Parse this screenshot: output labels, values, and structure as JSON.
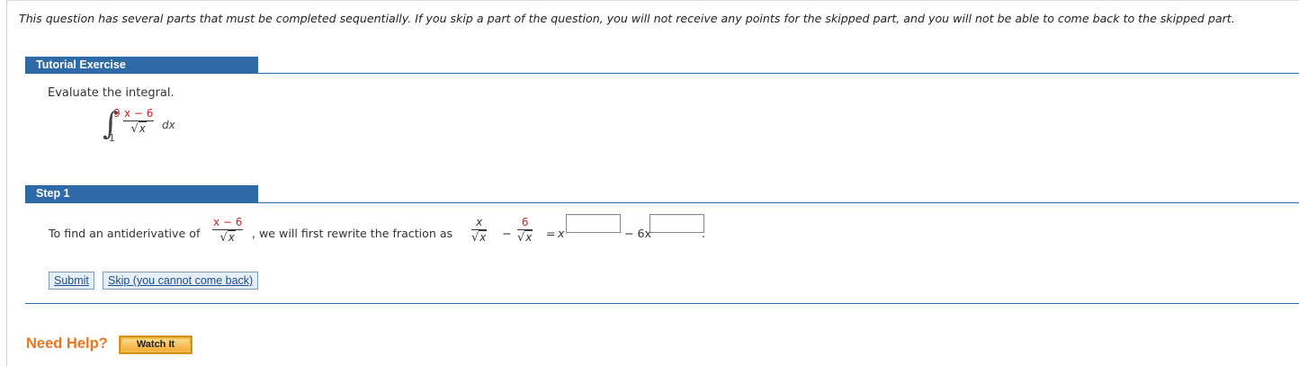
{
  "notice": "This question has several parts that must be completed sequentially. If you skip a part of the question, you will not receive any points for the skipped part, and you will not be able to come back to the skipped part.",
  "tutorial": {
    "header": "Tutorial Exercise",
    "prompt": "Evaluate the integral.",
    "integral": {
      "upper_limit": "9",
      "lower_limit": "1",
      "numerator": "x − 6",
      "radicand": "x",
      "differential": "dx"
    }
  },
  "step1": {
    "header": "Step 1",
    "text_before": "To find an antiderivative of",
    "frac_numerator": "x − 6",
    "frac_radicand": "x",
    "text_middle": ", we will first rewrite the fraction as",
    "term1_numerator": "x",
    "term1_radicand": "x",
    "minus": "−",
    "term2_numerator": "6",
    "term2_radicand": "x",
    "equals": "=",
    "base1": "x",
    "coef2": "− 6x",
    "period": ".",
    "answer1_value": "",
    "answer2_value": ""
  },
  "buttons": {
    "submit": "Submit",
    "skip": "Skip (you cannot come back)"
  },
  "help": {
    "label": "Need Help?",
    "watch": "Watch It"
  },
  "colors": {
    "header_blue": "#2e6aa8",
    "highlight_red": "#cc2222",
    "help_orange": "#e87722",
    "watch_gold": "#f5b94a"
  }
}
